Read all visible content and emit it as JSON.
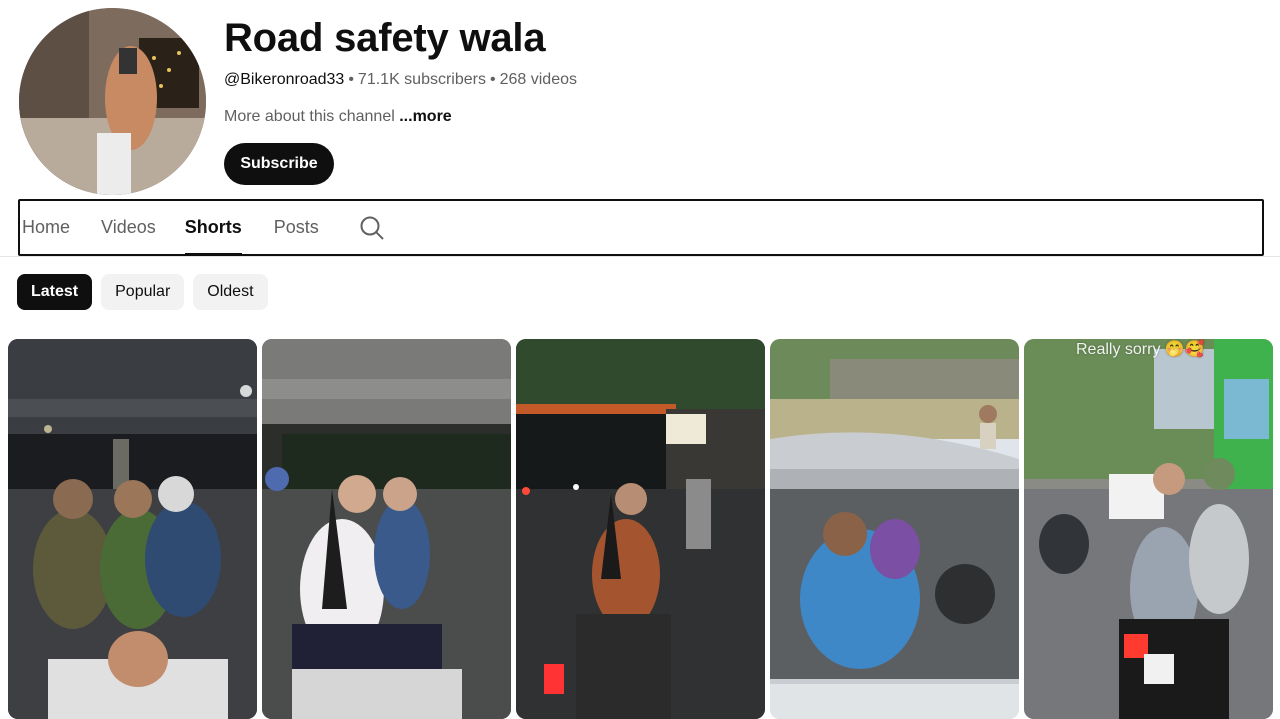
{
  "channel": {
    "name": "Road safety wala",
    "handle": "@Bikeronroad33",
    "subscribers": "71.1K subscribers",
    "videos": "268 videos",
    "separator": "•",
    "about": "More about this channel",
    "about_more": "...more",
    "subscribe_label": "Subscribe"
  },
  "tabs": [
    {
      "label": "Home",
      "active": false
    },
    {
      "label": "Videos",
      "active": false
    },
    {
      "label": "Shorts",
      "active": true
    },
    {
      "label": "Posts",
      "active": false
    }
  ],
  "search_icon": "search-icon",
  "chips": [
    {
      "label": "Latest",
      "selected": true
    },
    {
      "label": "Popular",
      "selected": false
    },
    {
      "label": "Oldest",
      "selected": false
    }
  ],
  "shorts": [
    {
      "scene": "three girls on scooter under flyover at night"
    },
    {
      "scene": "two girls on scooter under flyover at night"
    },
    {
      "scene": "girl on scooter on street at night"
    },
    {
      "scene": "man in blue shirt driving car"
    },
    {
      "scene": "girl on motorcycle on street by day",
      "overlay": "Really sorry 🤭🥰"
    }
  ],
  "colors": {
    "accent": "#0f0f0f",
    "secondary_text": "#606060",
    "chip_bg": "#f2f2f2"
  }
}
